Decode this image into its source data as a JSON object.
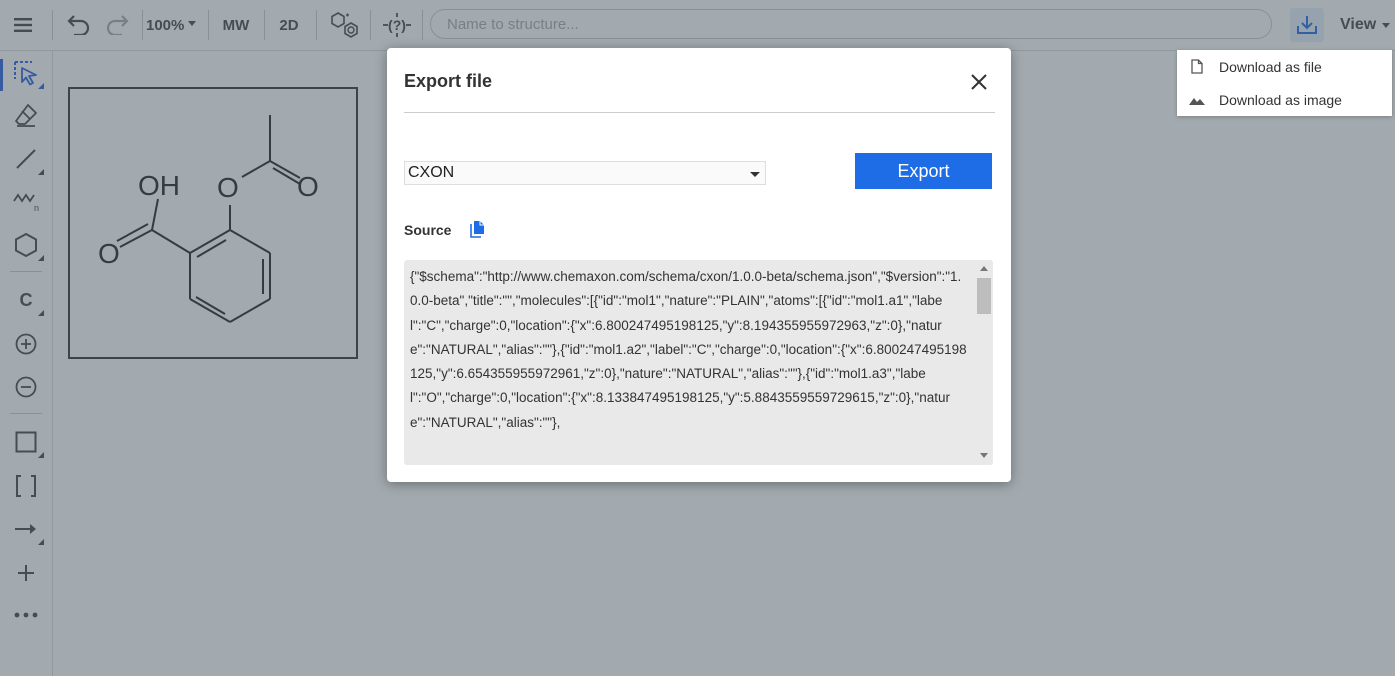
{
  "toolbar": {
    "zoom_label": "100%",
    "mw_label": "MW",
    "twod_label": "2D",
    "search_placeholder": "Name to structure...",
    "view_label": "View",
    "icons": [
      "menu-icon",
      "undo-icon",
      "redo-icon",
      "clean-structure-icon",
      "query-icon",
      "download-icon"
    ]
  },
  "left_toolbar": {
    "icons": [
      "select-icon",
      "eraser-icon",
      "single-bond-icon",
      "chain-icon",
      "ring-icon",
      "atom-c-icon",
      "charge-plus-icon",
      "charge-minus-icon",
      "rectangle-icon",
      "bracket-icon",
      "arrow-icon",
      "plus-icon",
      "more-icon"
    ],
    "atom_label": "C"
  },
  "download_menu": {
    "items": [
      {
        "label": "Download as file",
        "icon": "file-icon"
      },
      {
        "label": "Download as image",
        "icon": "image-icon"
      }
    ]
  },
  "molecule": {
    "labels": [
      "OH",
      "O",
      "O",
      "O"
    ]
  },
  "modal": {
    "title": "Export file",
    "format_selected": "CXON",
    "export_label": "Export",
    "source_label": "Source",
    "source_text": "{\"$schema\":\"http://www.chemaxon.com/schema/cxon/1.0.0-beta/schema.json\",\"$version\":\"1.0.0-beta\",\"title\":\"\",\"molecules\":[{\"id\":\"mol1\",\"nature\":\"PLAIN\",\"atoms\":[{\"id\":\"mol1.a1\",\"label\":\"C\",\"charge\":0,\"location\":{\"x\":6.800247495198125,\"y\":8.194355955972963,\"z\":0},\"nature\":\"NATURAL\",\"alias\":\"\"},{\"id\":\"mol1.a2\",\"label\":\"C\",\"charge\":0,\"location\":{\"x\":6.800247495198125,\"y\":6.654355955972961,\"z\":0},\"nature\":\"NATURAL\",\"alias\":\"\"},{\"id\":\"mol1.a3\",\"label\":\"O\",\"charge\":0,\"location\":{\"x\":8.133847495198125,\"y\":5.8843559559729615,\"z\":0},\"nature\":\"NATURAL\",\"alias\":\"\"},"
  }
}
